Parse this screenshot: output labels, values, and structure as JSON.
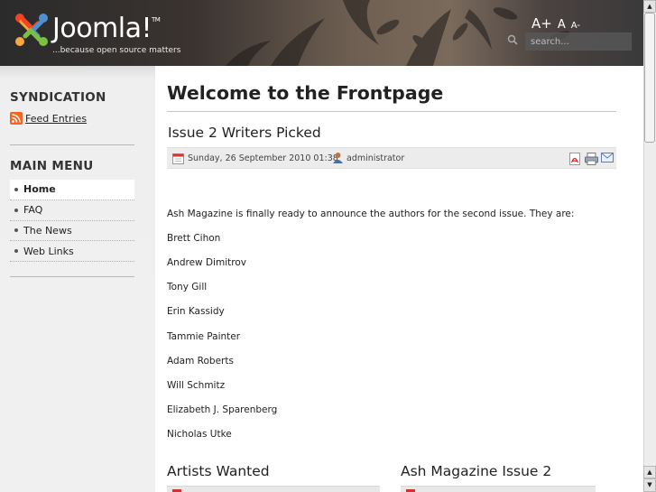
{
  "header": {
    "logo_word": "Joomla!",
    "logo_tm": "TM",
    "tagline": "...because open source matters",
    "font_tools": {
      "increase": "A+",
      "reset": "A",
      "decrease": "A-"
    },
    "search": {
      "placeholder": "search..."
    }
  },
  "sidebar": {
    "syndication_title": "SYNDICATION",
    "feed_link": "Feed Entries",
    "main_menu_title": "MAIN MENU",
    "menu_items": [
      {
        "label": "Home",
        "active": true
      },
      {
        "label": "FAQ",
        "active": false
      },
      {
        "label": "The News",
        "active": false
      },
      {
        "label": "Web Links",
        "active": false
      }
    ]
  },
  "main": {
    "page_title": "Welcome to the Frontpage",
    "article": {
      "title": "Issue 2 Writers Picked",
      "date": "Sunday, 26 September 2010 01:38",
      "author": "administrator",
      "intro": "Ash Magazine is finally ready to announce the authors for the second issue. They are:",
      "authors": [
        "Brett Cihon",
        "Andrew Dimitrov",
        "Tony Gill",
        "Erin Kassidy",
        "Tammie Painter",
        "Adam Roberts",
        "Will Schmitz",
        "Elizabeth J. Sparenberg",
        "Nicholas Utke"
      ]
    },
    "sub_articles": [
      {
        "title": "Artists Wanted"
      },
      {
        "title": "Ash Magazine Issue 2"
      }
    ]
  },
  "colors": {
    "header_dark": "#2b2b2b",
    "sidebar_bg": "#f0f0f0",
    "meta_bar_bg": "#ececec",
    "rss_orange": "#f26522"
  }
}
